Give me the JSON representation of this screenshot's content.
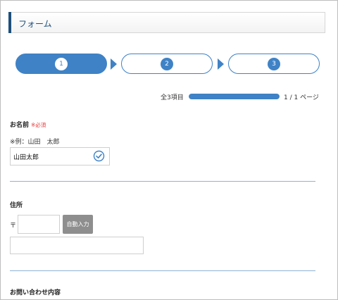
{
  "header": {
    "title": "フォーム"
  },
  "steps": [
    {
      "number": "1",
      "active": true
    },
    {
      "number": "2",
      "active": false
    },
    {
      "number": "3",
      "active": false
    }
  ],
  "progress": {
    "total_label": "全3項目",
    "fraction": 1.0,
    "page_label": "1 / 1 ページ"
  },
  "fields": {
    "name": {
      "label": "お名前",
      "required": "※必須",
      "example": "※例：山田　太郎",
      "value": "山田太郎"
    },
    "address": {
      "label": "住所",
      "postal_mark": "〒",
      "postal_value": "",
      "auto_button": "自動入力",
      "address_value": ""
    },
    "inquiry": {
      "label": "お問い合わせ内容"
    }
  },
  "colors": {
    "accent": "#3f82c6",
    "header_bar": "#1d4f7c",
    "required": "#e43b3b",
    "button_gray": "#8e8e8e"
  }
}
